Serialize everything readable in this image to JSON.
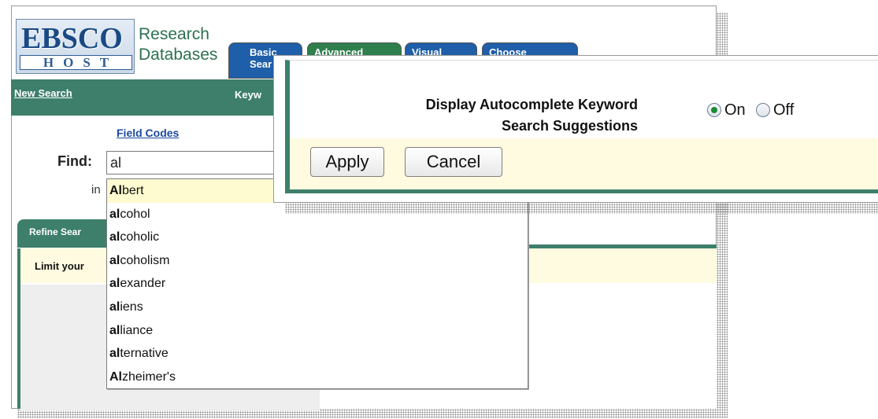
{
  "logo": {
    "ebsco": "EBSCO",
    "host": "HOST",
    "brand_line1": "Research",
    "brand_line2": "Databases"
  },
  "tabs": [
    {
      "label": "Basic\nSearch",
      "visible": "Basic\nSear"
    },
    {
      "label": "Advanced",
      "visible": "Advanced"
    },
    {
      "label": "Visual",
      "visible": "Visual"
    },
    {
      "label": "Choose",
      "visible": "Choose"
    }
  ],
  "nav": {
    "new_search": "New Search",
    "keyword_partial": "Keyw"
  },
  "search": {
    "field_codes": "Field Codes",
    "find_label": "Find:",
    "find_value": "al",
    "in_label": "in"
  },
  "autocomplete": {
    "items": [
      {
        "prefix": "Al",
        "rest": "bert",
        "highlighted": true
      },
      {
        "prefix": "al",
        "rest": "cohol"
      },
      {
        "prefix": "al",
        "rest": "coholic"
      },
      {
        "prefix": "al",
        "rest": "coholism"
      },
      {
        "prefix": "al",
        "rest": "exander"
      },
      {
        "prefix": "al",
        "rest": "iens"
      },
      {
        "prefix": "al",
        "rest": "liance"
      },
      {
        "prefix": "al",
        "rest": "ternative"
      },
      {
        "prefix": "Al",
        "rest": "zheimer's"
      }
    ]
  },
  "refine": {
    "header_partial": "Refine Sear",
    "limit_partial": "Limit your"
  },
  "popup": {
    "label_line1": "Display Autocomplete Keyword",
    "label_line2": "Search Suggestions",
    "option_on": "On",
    "option_off": "Off",
    "selected": "On",
    "apply": "Apply",
    "cancel": "Cancel"
  },
  "colors": {
    "green": "#3d7f6b",
    "tab_blue": "#1f5ea8",
    "highlight": "#fefbd0",
    "radio_dot": "#1b8a32"
  }
}
